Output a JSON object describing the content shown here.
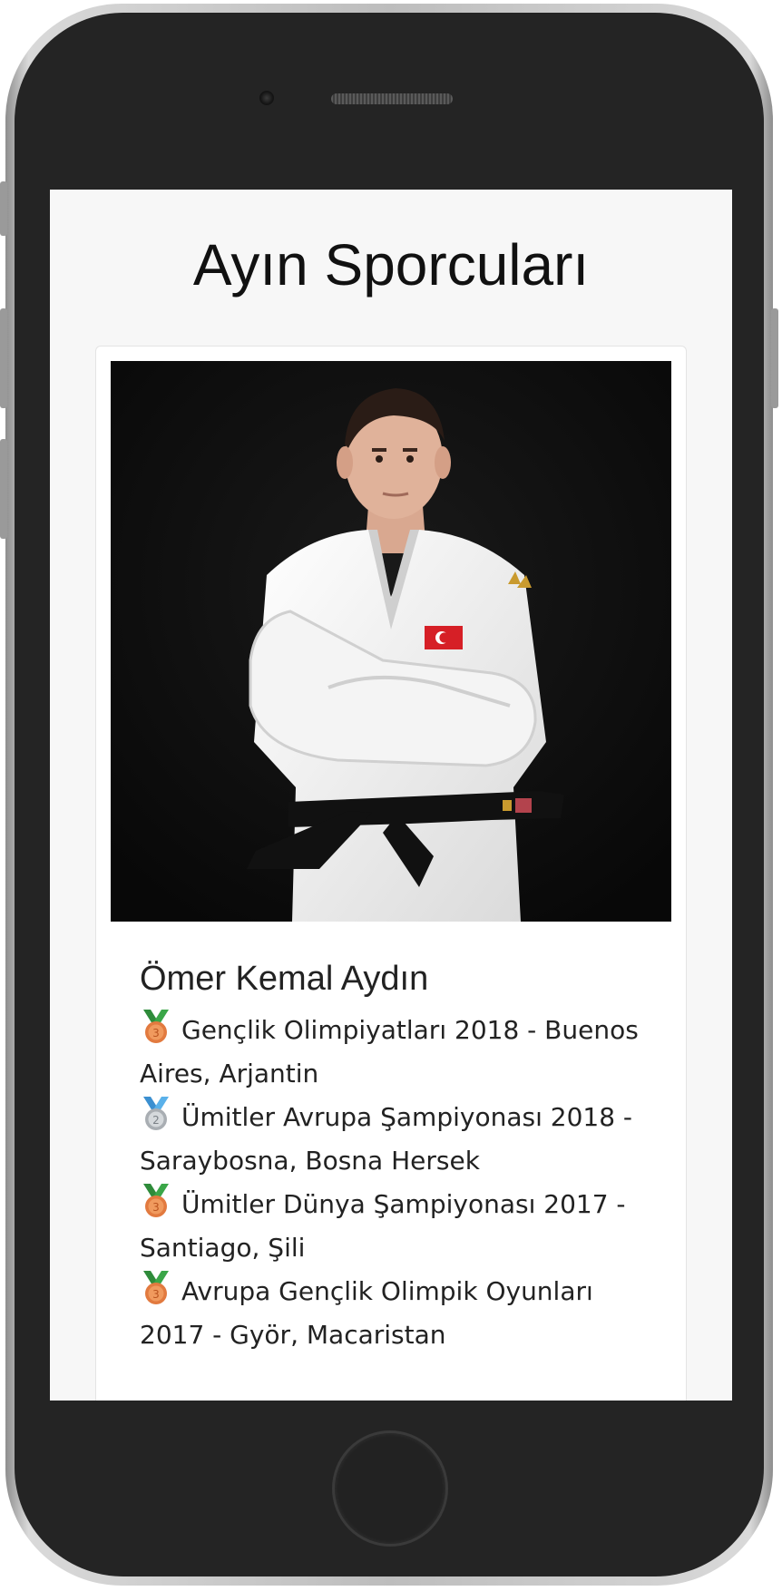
{
  "page": {
    "title": "Ayın Sporcuları"
  },
  "athlete": {
    "name": "Ömer Kemal Aydın",
    "photo_icon": "judoka-portrait",
    "achievements": [
      {
        "medal": "bronze",
        "medal_number": "3",
        "text": "Gençlik Olimpiyatları 2018 - Buenos Aires, Arjantin"
      },
      {
        "medal": "silver",
        "medal_number": "2",
        "text": "Ümitler Avrupa Şampiyonası 2018 - Saraybosna, Bosna Hersek"
      },
      {
        "medal": "bronze",
        "medal_number": "3",
        "text": "Ümitler Dünya Şampiyonası 2017 - Santiago, Şili"
      },
      {
        "medal": "bronze",
        "medal_number": "3",
        "text": "Avrupa Gençlik Olimpik Oyunları 2017 - Györ, Macaristan"
      }
    ]
  },
  "colors": {
    "bronze": "#e27a3f",
    "silver": "#c8cdd1",
    "ribbon_green": "#2e8b3a",
    "ribbon_blue": "#4aa3df"
  }
}
